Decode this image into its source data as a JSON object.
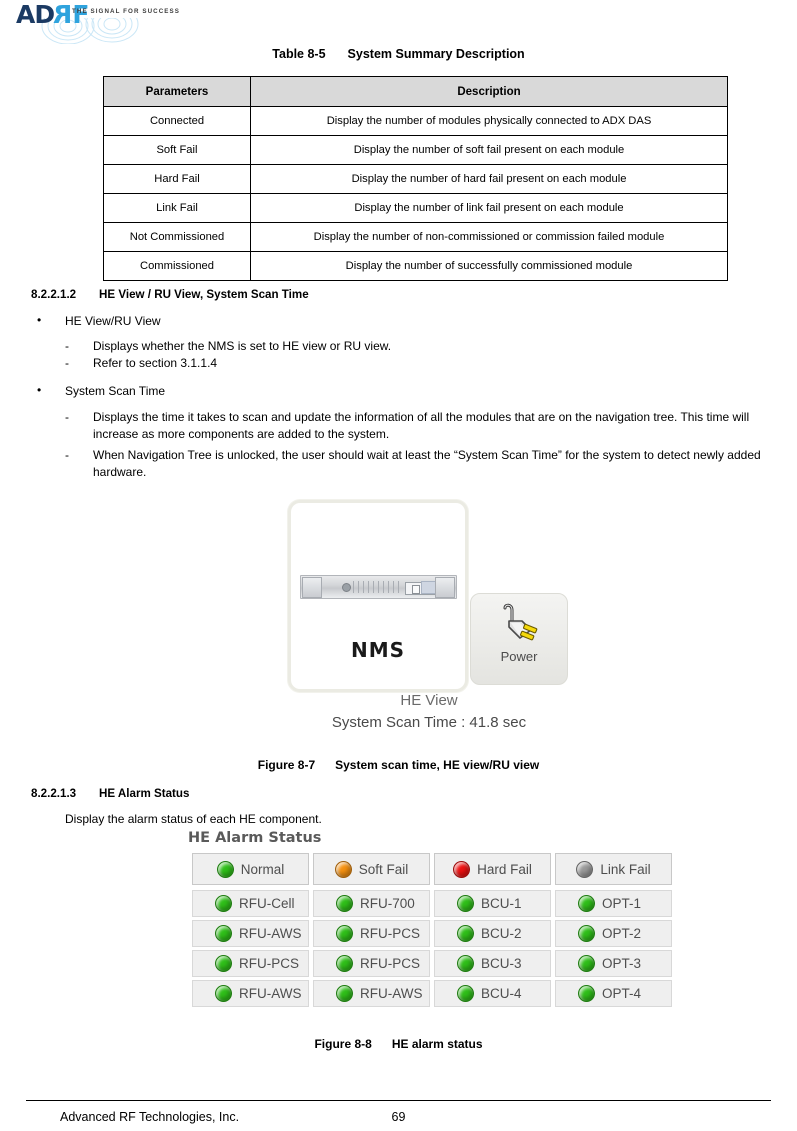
{
  "header": {
    "logo_main": "AD",
    "logo_r": "R",
    "logo_f": "F",
    "logo_tagline": "THE SIGNAL FOR SUCCESS"
  },
  "table": {
    "caption_number": "Table 8-5",
    "caption_title": "System Summary Description",
    "headers": [
      "Parameters",
      "Description"
    ],
    "rows": [
      [
        "Connected",
        "Display the number of modules physically connected to ADX DAS"
      ],
      [
        "Soft Fail",
        "Display the number of soft fail present on each module"
      ],
      [
        "Hard Fail",
        "Display the number of hard fail present on each module"
      ],
      [
        "Link Fail",
        "Display the number of link fail present on each module"
      ],
      [
        "Not Commissioned",
        "Display the number of non-commissioned or commission failed module"
      ],
      [
        "Commissioned",
        "Display the number of successfully commissioned module"
      ]
    ]
  },
  "section_8_2_2_1_2": {
    "number": "8.2.2.1.2",
    "title": "HE View / RU View, System Scan Time",
    "bullet1": "HE View/RU View",
    "bullet1_sub1": "Displays whether the NMS is set to HE view or RU view.",
    "bullet1_sub2": "Refer to section 3.1.1.4",
    "bullet2": "System Scan Time",
    "bullet2_sub1": "Displays the time it takes to scan and update the information of all the modules that are on the navigation tree.  This time will increase as more components are added to the system.",
    "bullet2_sub2": "When Navigation Tree is unlocked, the user should wait at least the “System Scan Time” for the system to detect newly added hardware."
  },
  "figure_8_7": {
    "nms_label": "NMS",
    "power_label": "Power",
    "view_mode": "HE View",
    "scan_time": "System Scan Time : 41.8 sec",
    "caption_number": "Figure 8-7",
    "caption_title": "System scan time, HE view/RU view"
  },
  "section_8_2_2_1_3": {
    "number": "8.2.2.1.3",
    "title": "HE Alarm Status",
    "body": "Display the alarm status of each HE component."
  },
  "figure_8_8": {
    "panel_title": "HE Alarm Status",
    "legend": [
      {
        "label": "Normal",
        "color": "#2fbf19"
      },
      {
        "label": "Soft Fail",
        "color": "#f59111"
      },
      {
        "label": "Hard Fail",
        "color": "#ee1111"
      },
      {
        "label": "Link Fail",
        "color": "#9a9a9a"
      }
    ],
    "grid": [
      [
        {
          "label": "RFU-Cell",
          "color": "#2fbf19"
        },
        {
          "label": "RFU-700",
          "color": "#2fbf19"
        },
        {
          "label": "BCU-1",
          "color": "#2fbf19"
        },
        {
          "label": "OPT-1",
          "color": "#2fbf19"
        }
      ],
      [
        {
          "label": "RFU-AWS",
          "color": "#2fbf19"
        },
        {
          "label": "RFU-PCS",
          "color": "#2fbf19"
        },
        {
          "label": "BCU-2",
          "color": "#2fbf19"
        },
        {
          "label": "OPT-2",
          "color": "#2fbf19"
        }
      ],
      [
        {
          "label": "RFU-PCS",
          "color": "#2fbf19"
        },
        {
          "label": "RFU-PCS",
          "color": "#2fbf19"
        },
        {
          "label": "BCU-3",
          "color": "#2fbf19"
        },
        {
          "label": "OPT-3",
          "color": "#2fbf19"
        }
      ],
      [
        {
          "label": "RFU-AWS",
          "color": "#2fbf19"
        },
        {
          "label": "RFU-AWS",
          "color": "#2fbf19"
        },
        {
          "label": "BCU-4",
          "color": "#2fbf19"
        },
        {
          "label": "OPT-4",
          "color": "#2fbf19"
        }
      ]
    ],
    "caption_number": "Figure 8-8",
    "caption_title": "HE alarm status"
  },
  "footer": {
    "company": "Advanced RF Technologies, Inc.",
    "page_number": "69"
  }
}
